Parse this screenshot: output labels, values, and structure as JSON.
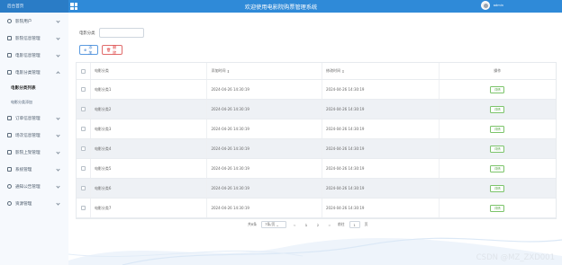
{
  "topbar": {
    "brand": "后台首页",
    "title": "欢迎使用电影院购票管理系统",
    "username": "admin"
  },
  "sidebar": {
    "items": [
      {
        "label": "影院用户",
        "icon": "user-icon"
      },
      {
        "label": "影院信息管理",
        "icon": "list-icon"
      },
      {
        "label": "电影信息管理",
        "icon": "list-icon"
      },
      {
        "label": "电影分类管理",
        "icon": "list-icon"
      }
    ],
    "sub_active": "电影分类列表",
    "sub_small": "电影分类添加",
    "items2": [
      {
        "label": "订单信息管理",
        "icon": "list-icon"
      },
      {
        "label": "场次信息管理",
        "icon": "list-icon"
      },
      {
        "label": "影院上架管理",
        "icon": "list-icon"
      },
      {
        "label": "系统管理",
        "icon": "settings-icon"
      },
      {
        "label": "通知公告管理",
        "icon": "info-icon"
      },
      {
        "label": "资源管理",
        "icon": "gear-icon"
      }
    ]
  },
  "search": {
    "label": "电影分类"
  },
  "buttons": {
    "add": "添加",
    "delete": "删除"
  },
  "table": {
    "headers": [
      "电影分类",
      "添加时间",
      "修改时间",
      "操作"
    ],
    "rows": [
      {
        "name": "电影分类1",
        "created": "2024-04-26 14:30:19",
        "updated": "2024-04-26 14:30:19",
        "action": "详情"
      },
      {
        "name": "电影分类2",
        "created": "2024-04-26 14:30:19",
        "updated": "2024-04-26 14:30:19",
        "action": "详情"
      },
      {
        "name": "电影分类3",
        "created": "2024-04-26 14:30:19",
        "updated": "2024-04-26 14:30:19",
        "action": "详情"
      },
      {
        "name": "电影分类4",
        "created": "2024-04-26 14:30:19",
        "updated": "2024-04-26 14:30:19",
        "action": "详情"
      },
      {
        "name": "电影分类5",
        "created": "2024-04-26 14:30:19",
        "updated": "2024-04-26 14:30:19",
        "action": "详情"
      },
      {
        "name": "电影分类6",
        "created": "2024-04-26 14:30:19",
        "updated": "2024-04-26 14:30:19",
        "action": "详情"
      },
      {
        "name": "电影分类7",
        "created": "2024-04-26 14:30:19",
        "updated": "2024-04-26 14:30:19",
        "action": "详情"
      }
    ]
  },
  "pager": {
    "total": "共8条",
    "per_page": "7条/页",
    "prev": "<",
    "pages": [
      "1",
      "2"
    ],
    "next": ">",
    "goto_label": "前往",
    "goto_value": "1",
    "goto_suffix": "页"
  },
  "watermark": "CSDN @MZ_ZXD001",
  "colors": {
    "topbar": "#2f8ad8",
    "accent": "#3478cc",
    "danger": "#d33333",
    "success": "#5aa64a"
  }
}
